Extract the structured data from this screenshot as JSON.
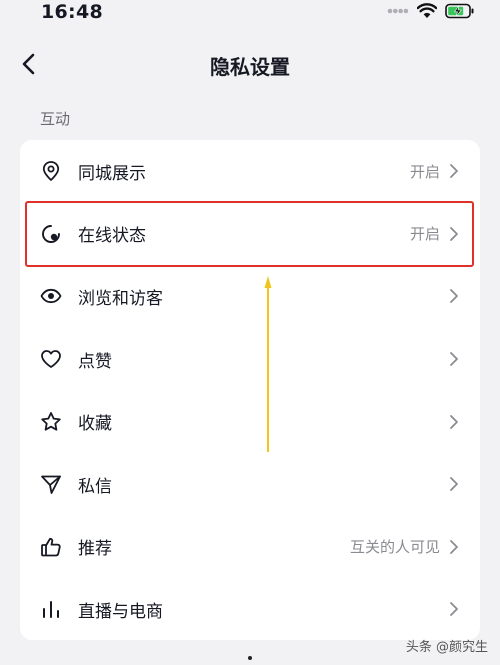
{
  "status_bar": {
    "time": "16:48"
  },
  "header": {
    "title": "隐私设置"
  },
  "section": {
    "title": "互动"
  },
  "settings": [
    {
      "label": "同城展示",
      "value": "开启",
      "icon": "location-pin-icon"
    },
    {
      "label": "在线状态",
      "value": "开启",
      "icon": "online-status-icon"
    },
    {
      "label": "浏览和访客",
      "value": "",
      "icon": "eye-icon"
    },
    {
      "label": "点赞",
      "value": "",
      "icon": "heart-icon"
    },
    {
      "label": "收藏",
      "value": "",
      "icon": "star-icon"
    },
    {
      "label": "私信",
      "value": "",
      "icon": "send-icon"
    },
    {
      "label": "推荐",
      "value": "互关的人可见",
      "icon": "thumbs-up-icon"
    },
    {
      "label": "直播与电商",
      "value": "",
      "icon": "bar-chart-icon"
    }
  ],
  "annotations": {
    "highlight_color": "#e0302a",
    "arrow_color": "#f0c419"
  },
  "watermark": {
    "text": "头条 @颜究生"
  }
}
